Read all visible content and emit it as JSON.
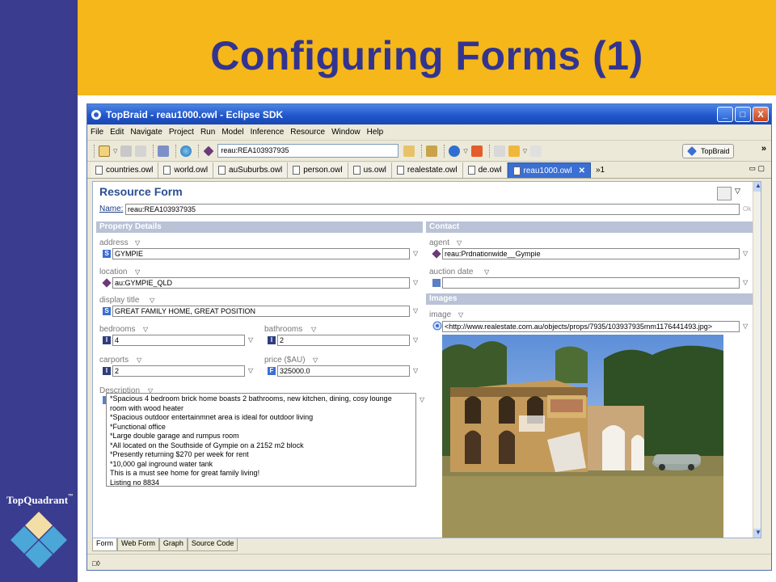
{
  "slide": {
    "title": "Configuring Forms (1)",
    "brand": "TopQuadrant",
    "brand_tm": "™"
  },
  "colors": {
    "sidebar": "#3a3c8f",
    "header": "#f5b719",
    "title_text": "#33348f"
  },
  "window": {
    "title": "TopBraid - reau1000.owl - Eclipse SDK",
    "minimize": "_",
    "maximize": "□",
    "close": "X"
  },
  "menu": [
    "File",
    "Edit",
    "Navigate",
    "Project",
    "Run",
    "Model",
    "Inference",
    "Resource",
    "Window",
    "Help"
  ],
  "toolbar": {
    "resource_value": "reau:REA103937935",
    "perspective_label": "TopBraid",
    "overflow": "»"
  },
  "tabs": [
    {
      "label": "countries.owl"
    },
    {
      "label": "world.owl"
    },
    {
      "label": "auSuburbs.owl"
    },
    {
      "label": "person.owl"
    },
    {
      "label": "us.owl"
    },
    {
      "label": "realestate.owl"
    },
    {
      "label": "de.owl"
    },
    {
      "label": "reau1000.owl",
      "close": "✕"
    }
  ],
  "tab_overflow": "»1",
  "form": {
    "title": "Resource Form",
    "name_label": "Name:",
    "name_value": "reau:REA103937935",
    "name_ok": "Ok",
    "sections": {
      "property_details": "Property Details",
      "contact": "Contact",
      "images": "Images"
    },
    "fields": {
      "address": {
        "label": "address",
        "type": "S",
        "value": "GYMPIE"
      },
      "location": {
        "label": "location",
        "value": "au:GYMPIE_QLD"
      },
      "display_title": {
        "label": "display title",
        "type": "S",
        "value": "GREAT FAMILY HOME, GREAT POSITION"
      },
      "bedrooms": {
        "label": "bedrooms",
        "type": "I",
        "value": "4"
      },
      "bathrooms": {
        "label": "bathrooms",
        "type": "I",
        "value": "2"
      },
      "carports": {
        "label": "carports",
        "type": "I",
        "value": "2"
      },
      "price": {
        "label": "price ($AU)",
        "type": "F",
        "value": "325000.0"
      },
      "agent": {
        "label": "agent",
        "value": "reau:Prdnationwide__Gympie"
      },
      "auction_date": {
        "label": "auction date",
        "value": ""
      },
      "image": {
        "label": "image",
        "value": "<http://www.realestate.com.au/objects/props/7935/103937935mm1176441493.jpg>"
      }
    },
    "description": {
      "label": "Description",
      "lines": [
        "*Spacious 4 bedroom brick home boasts 2 bathrooms, new kitchen, dining, cosy lounge",
        "room with wood heater",
        "*Spacious outdoor entertainmnet area is ideal for outdoor living",
        "*Functional office",
        "*Large double garage and rumpus room",
        "*All located on the Southside of Gympie on a 2152 m2 block",
        "*Presently returning $270 per week for rent",
        "*10,000 gal inground water tank",
        "This is a must see home for great family living!",
        "Listing no 8834"
      ]
    }
  },
  "bottom_tabs": [
    "Form",
    "Web Form",
    "Graph",
    "Source Code"
  ],
  "status": {
    "icon_text": "□◊"
  },
  "icons": {
    "dropdown": "▽",
    "scroll_up": "▲",
    "scroll_down": "▼"
  }
}
